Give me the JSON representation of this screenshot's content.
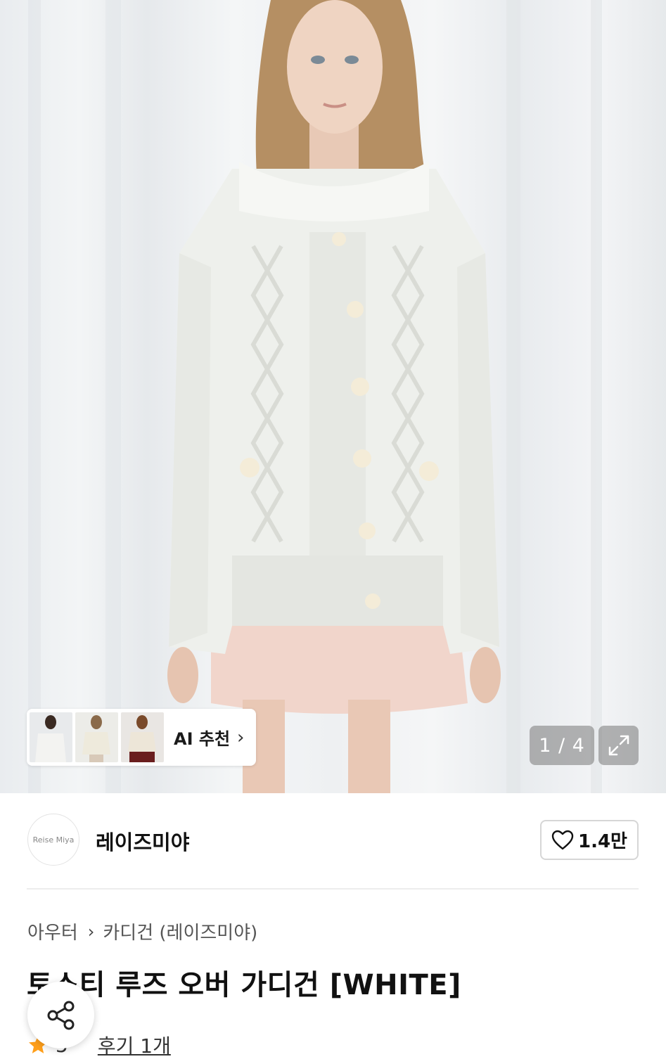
{
  "image_counter": {
    "current": "1",
    "total": "4",
    "text": "1 / 4"
  },
  "recommend": {
    "label": "AI 추천"
  },
  "brand": {
    "logo_text": "Reise Miya",
    "name": "레이즈미야"
  },
  "like": {
    "count": "1.4만"
  },
  "breadcrumb": {
    "items": [
      "아우터",
      "카디건 (레이즈미야)"
    ]
  },
  "product": {
    "title": "토스티 루즈 오버 가디건 [WHITE]"
  },
  "review": {
    "rating": "5",
    "link_text": "후기 1개"
  },
  "colors": {
    "accent_star": "#ff9f1a",
    "text": "#111111",
    "border": "#d6d6d6"
  }
}
